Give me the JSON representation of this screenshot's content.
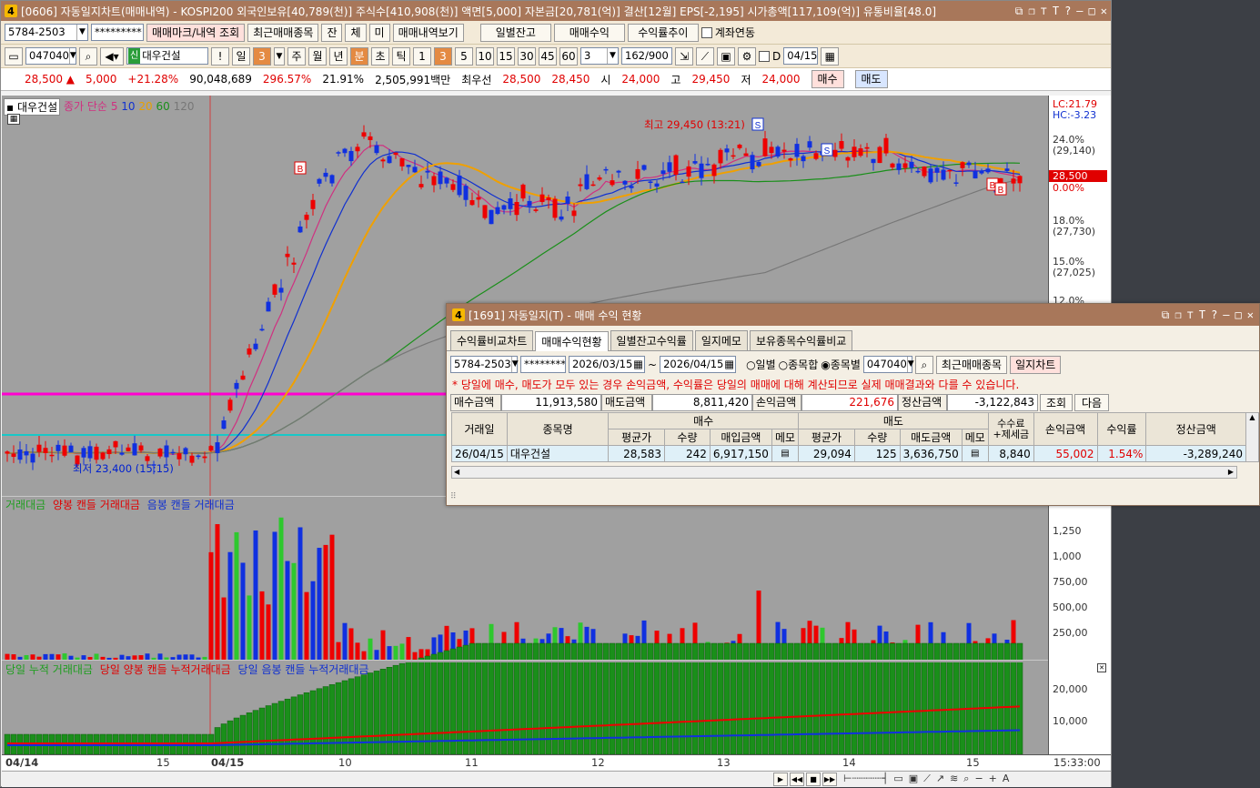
{
  "main": {
    "title_num": "4",
    "title": "[0606] 자동일지차트(매매내역) - KOSPI200 외국인보유[40,789(천)] 주식수[410,908(천)] 액면[5,000] 자본금[20,781(억)] 결산[12월] EPS[-2,195] 시가총액[117,109(억)] 유통비율[48.0]",
    "account": "5784-2503",
    "password": "*********",
    "btn_mark": "매매마크/내역 조회",
    "btn_recent": "최근매매종목",
    "btn_jan": "잔",
    "btn_che": "체",
    "btn_mi": "미",
    "btn_history": "매매내역보기",
    "btn_daily_balance": "일별잔고",
    "btn_trade_profit": "매매수익",
    "btn_return_trend": "수익률추이",
    "chk_account_link": "계좌연동",
    "code": "047040",
    "stock_name": "대우건설",
    "badge_sin": "신",
    "btn_warn": "!",
    "period_day": "일",
    "period_day_n": "3",
    "period_week": "주",
    "period_month": "월",
    "period_year": "년",
    "period_minute": "분",
    "period_sec": "초",
    "period_tick": "틱",
    "intervals": [
      "1",
      "3",
      "5",
      "10",
      "15",
      "30",
      "45",
      "60"
    ],
    "interval_input": "3",
    "count": "162",
    "count_total": "/900",
    "date_label": "D",
    "date_value": "04/15",
    "quote": {
      "price": "28,500 ▲",
      "change": "5,000",
      "change_pct": "+21.28%",
      "volume": "90,048,689",
      "vol_ratio": "296.57%",
      "turnover": "21.91%",
      "amount": "2,505,991백만",
      "best_label": "최우선",
      "ask": "28,500",
      "bid": "28,450",
      "open_label": "시",
      "open": "24,000",
      "high_label": "고",
      "high": "29,450",
      "low_label": "저",
      "low": "24,000",
      "buy": "매수",
      "sell": "매도"
    }
  },
  "chart": {
    "stock_label": "대우건설",
    "legend_price": "종가 단순",
    "ma_periods": [
      "5",
      "10",
      "20",
      "60",
      "120"
    ],
    "high_annot": "최고 29,450 (13:21)",
    "low_annot": "최저 23,400 (15:15)",
    "lc": "LC:21.79",
    "hc": "HC:-3.23",
    "y_price": [
      {
        "pct": "24.0%",
        "val": "(29,140)"
      },
      {
        "pct": "18.0%",
        "val": "(27,730)"
      },
      {
        "pct": "15.0%",
        "val": "(27,025)"
      },
      {
        "pct": "12.0%",
        "val": ""
      }
    ],
    "current_price": "28,500",
    "current_pct": "0.00%",
    "vol_legend": [
      "거래대금",
      "양봉 캔들 거래대금",
      "음봉 캔들 거래대금"
    ],
    "y_vol": [
      "1,250",
      "1,000",
      "750,00",
      "500,00",
      "250,00"
    ],
    "cum_legend": [
      "당일 누적 거래대금",
      "당일 양봉 캔들 누적거래대금",
      "당일 음봉 캔들 누적거래대금"
    ],
    "y_cum": [
      "20,000",
      "10,000"
    ],
    "x_labels": [
      "04/14",
      "15",
      "04/15",
      "10",
      "11",
      "12",
      "13",
      "14",
      "15"
    ],
    "x_time": "15:33:00"
  },
  "popup": {
    "title_num": "4",
    "title": "[1691] 자동일지(T) - 매매 수익 현황",
    "tabs": [
      "수익률비교차트",
      "매매수익현황",
      "일별잔고수익률",
      "일지메모",
      "보유종목수익률비교"
    ],
    "account": "5784-2503",
    "password": "*********",
    "date_from": "2026/03/15",
    "date_sep": "~",
    "date_to": "2026/04/15",
    "radio_daily": "일별",
    "radio_stock_sum": "종목합",
    "radio_by_stock": "종목별",
    "code": "047040",
    "btn_recent": "최근매매종목",
    "btn_journal_chart": "일지차트",
    "warning": "* 당일에 매수, 매도가 모두 있는 경우 손익금액, 수익률은 당일의 매매에 대해 계산되므로 실제 매매결과와 다를 수 있습니다.",
    "sum": {
      "buy_label": "매수금액",
      "buy": "11,913,580",
      "sell_label": "매도금액",
      "sell": "8,811,420",
      "pl_label": "손익금액",
      "pl": "221,676",
      "settle_label": "정산금액",
      "settle": "-3,122,843",
      "btn_query": "조회",
      "btn_next": "다음"
    },
    "table": {
      "h_date": "거래일",
      "h_name": "종목명",
      "h_buy": "매수",
      "h_sell": "매도",
      "h_fee": "수수료 +제세금",
      "h_pl": "손익금액",
      "h_rate": "수익률",
      "h_settle": "정산금액",
      "h_avg": "평균가",
      "h_qty": "수량",
      "h_buy_amt": "매입금액",
      "h_memo": "메모",
      "h_avg2": "평균가",
      "h_qty2": "수량",
      "h_sell_amt": "매도금액",
      "h_memo2": "메모",
      "row": {
        "date": "26/04/15",
        "name": "대우건설",
        "buy_avg": "28,583",
        "buy_qty": "242",
        "buy_amt": "6,917,150",
        "sell_avg": "29,094",
        "sell_qty": "125",
        "sell_amt": "3,636,750",
        "fee": "8,840",
        "pl": "55,002",
        "rate": "1.54%",
        "settle": "-3,289,240"
      }
    }
  }
}
